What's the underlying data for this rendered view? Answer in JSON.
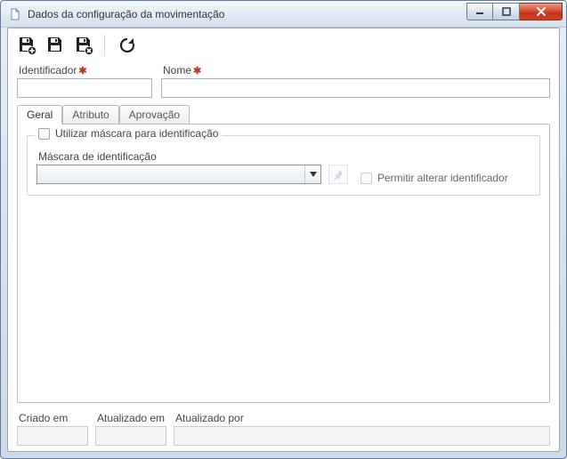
{
  "window": {
    "title": "Dados da configuração da movimentação"
  },
  "toolbar": {
    "save_new_icon": "floppy-plus",
    "save_icon": "floppy",
    "save_close_icon": "floppy-x",
    "refresh_icon": "refresh"
  },
  "form": {
    "identifier_label": "Identificador",
    "identifier_value": "",
    "name_label": "Nome",
    "name_value": ""
  },
  "tabs": {
    "geral": "Geral",
    "atributo": "Atributo",
    "aprovacao": "Aprovação"
  },
  "geral": {
    "use_mask_label": "Utilizar máscara para identificação",
    "use_mask_checked": false,
    "mask_label": "Máscara de identificação",
    "mask_selected": "",
    "allow_edit_id_label": "Permitir alterar identificador",
    "allow_edit_id_checked": false
  },
  "footer": {
    "created_label": "Criado em",
    "created_value": "",
    "updated_label": "Atualizado em",
    "updated_value": "",
    "updated_by_label": "Atualizado por",
    "updated_by_value": ""
  }
}
